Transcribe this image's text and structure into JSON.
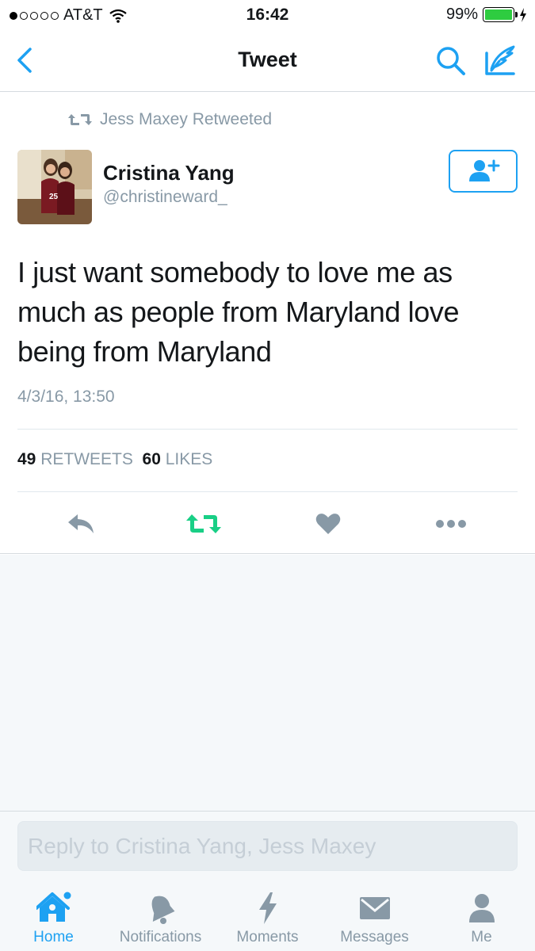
{
  "status_bar": {
    "carrier": "AT&T",
    "time": "16:42",
    "battery": "99%",
    "battery_level": 0.99,
    "signal_bars_filled": 1,
    "signal_bars_total": 5
  },
  "nav": {
    "title": "Tweet",
    "back_icon": "chevron-left-icon",
    "search_icon": "search-icon",
    "compose_icon": "compose-icon"
  },
  "tweet": {
    "retweeted_by": "Jess Maxey Retweeted",
    "author_name": "Cristina Yang",
    "author_handle": "@christineward_",
    "text": "I just want somebody to love me as much as people from Maryland love being from Maryland",
    "timestamp": "4/3/16, 13:50",
    "retweet_count": "49",
    "retweet_label": "RETWEETS",
    "like_count": "60",
    "like_label": "LIKES"
  },
  "reply": {
    "placeholder": "Reply to Cristina Yang, Jess Maxey",
    "value": ""
  },
  "tabs": [
    {
      "label": "Home",
      "icon": "home-icon",
      "active": true
    },
    {
      "label": "Notifications",
      "icon": "bell-icon",
      "active": false
    },
    {
      "label": "Moments",
      "icon": "lightning-icon",
      "active": false
    },
    {
      "label": "Messages",
      "icon": "envelope-icon",
      "active": false
    },
    {
      "label": "Me",
      "icon": "person-icon",
      "active": false
    }
  ],
  "colors": {
    "accent": "#1da1f2",
    "retweet_green": "#19cf86",
    "muted": "#8899a6",
    "battery_green": "#2ecc40"
  }
}
